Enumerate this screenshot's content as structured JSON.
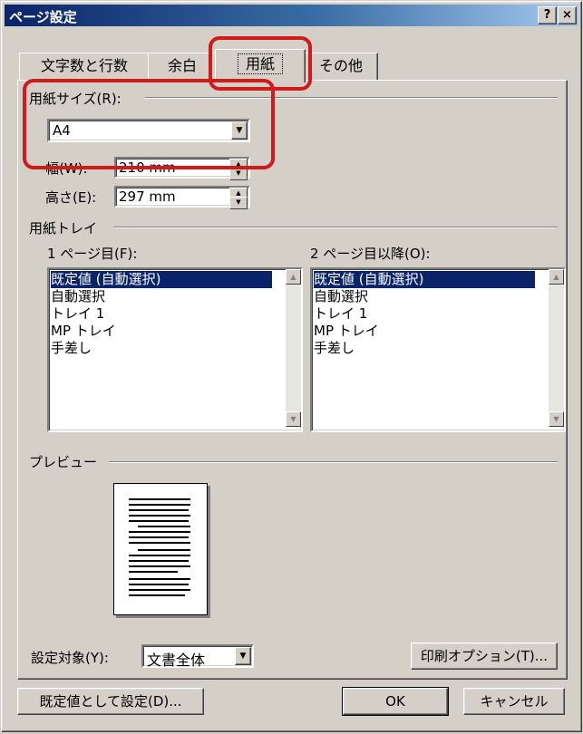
{
  "window": {
    "title": "ページ設定",
    "help_label": "?",
    "close_label": "×"
  },
  "tabs": [
    {
      "label": "文字数と行数",
      "active": false
    },
    {
      "label": "余白",
      "active": false
    },
    {
      "label": "用紙",
      "active": true
    },
    {
      "label": "その他",
      "active": false
    }
  ],
  "paper_size": {
    "label": "用紙サイズ(R):",
    "value": "A4",
    "width_label": "幅(W):",
    "width_value": "210 mm",
    "height_label": "高さ(E):",
    "height_value": "297 mm"
  },
  "paper_tray": {
    "label": "用紙トレイ",
    "first_page_label": "1 ページ目(F):",
    "other_pages_label": "2 ページ目以降(O):",
    "first_page_options": [
      "既定値 (自動選択)",
      "自動選択",
      "トレイ 1",
      "MP トレイ",
      "手差し"
    ],
    "other_pages_options": [
      "既定値 (自動選択)",
      "自動選択",
      "トレイ 1",
      "MP トレイ",
      "手差し"
    ],
    "selected_index": 0
  },
  "preview": {
    "label": "プレビュー",
    "apply_to_label": "設定対象(Y):",
    "apply_to_value": "文書全体",
    "print_options_label": "印刷オプション(T)..."
  },
  "footer": {
    "default_label": "既定値として設定(D)...",
    "ok_label": "OK",
    "cancel_label": "キャンセル"
  },
  "colors": {
    "title_bar": "#0a246a",
    "selection": "#0a246a",
    "highlight": "#d11a1a",
    "face": "#d4d0c8"
  },
  "icons": [
    "chevron-down-icon",
    "spin-up-icon",
    "spin-down-icon",
    "scroll-up-icon",
    "scroll-down-icon"
  ]
}
